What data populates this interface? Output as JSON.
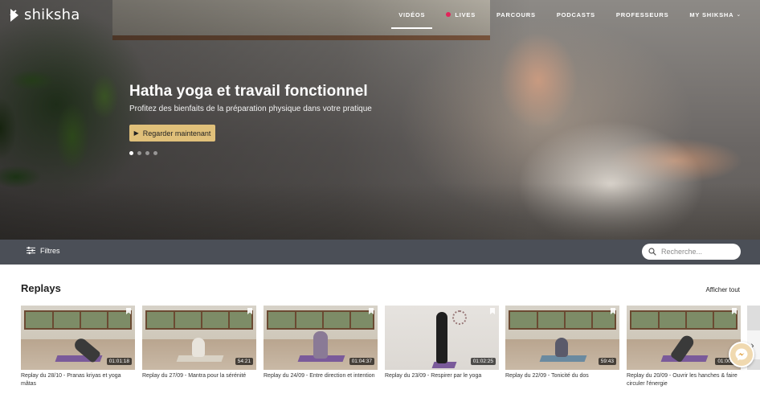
{
  "brand": {
    "name": "shiksha"
  },
  "nav": {
    "items": [
      {
        "label": "VIDÉOS",
        "active": true
      },
      {
        "label": "LIVES",
        "live": true
      },
      {
        "label": "PARCOURS"
      },
      {
        "label": "PODCASTS"
      },
      {
        "label": "PROFESSEURS"
      },
      {
        "label": "MY SHIKSHA",
        "dropdown": true
      }
    ]
  },
  "hero": {
    "title": "Hatha yoga et travail fonctionnel",
    "subtitle": "Profitez des bienfaits de la préparation physique dans votre pratique",
    "cta_label": "Regarder maintenant",
    "slide_count": 4,
    "active_slide": 1
  },
  "filters": {
    "label": "Filtres",
    "search_placeholder": "Recherche..."
  },
  "replays": {
    "title": "Replays",
    "show_all": "Afficher tout",
    "videos": [
      {
        "title": "Replay du 28/10 - Pranas kriyas et yoga mâtas",
        "duration": "01:01:18"
      },
      {
        "title": "Replay du 27/09 - Mantra pour la sérénité",
        "duration": "54:21"
      },
      {
        "title": "Replay du 24/09 - Entre direction et intention",
        "duration": "01:04:37"
      },
      {
        "title": "Replay du 23/09 - Respirer par le yoga",
        "duration": "01:02:25"
      },
      {
        "title": "Replay du 22/09 - Tonicité du dos",
        "duration": "59:43"
      },
      {
        "title": "Replay du 20/09 - Ouvrir les hanches & faire circuler l'énergie",
        "duration": "01:00:1"
      }
    ]
  },
  "colors": {
    "cta": "#e0c07a",
    "filter_bar": "#4b4f57",
    "live_dot": "#e2245a"
  }
}
